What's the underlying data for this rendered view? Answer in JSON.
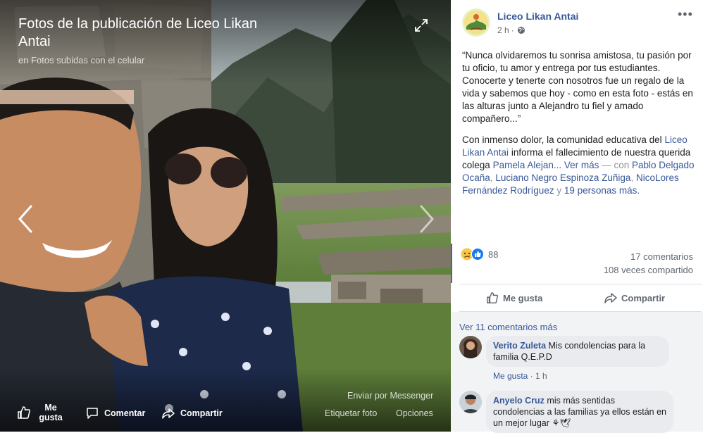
{
  "viewer": {
    "title": "Fotos de la publicación de Liceo Likan Antai",
    "subtitle": "en Fotos subidas con el celular",
    "messenger": "Enviar por Messenger",
    "like_label": "Me gusta",
    "comment_label": "Comentar",
    "share_label": "Compartir",
    "tag_label": "Etiquetar foto",
    "options_label": "Opciones"
  },
  "post": {
    "page_name": "Liceo Likan Antai",
    "time": "2 h",
    "time_sep": "·",
    "quote": "“Nunca olvidaremos tu sonrisa amistosa, tu pasión por tu oficio, tu amor y entrega por tus estudiantes. Conocerte y tenerte con nosotros fue un regalo de la vida y sabemos que hoy - como en esta foto - estás en las alturas junto a Alejandro tu fiel y amado compañero...”",
    "body_intro": "Con inmenso dolor, la comunidad educativa del",
    "body_link": "Liceo Likan Antai",
    "body_mid": "informa el fallecimiento de nuestra querida colega",
    "body_name": "Pamela Alejan...",
    "see_more": "Ver más",
    "dash": "—",
    "with": "con",
    "tag_1": "Pablo Delgado Ocaña",
    "tag_2": "Luciano Negro Espinoza Zuñiga",
    "tag_3": "NicoLores Fernández Rodríguez",
    "sep_comma": ",",
    "and": "y",
    "tag_more": "19 personas más.",
    "reaction_count": "88",
    "comments_count": "17 comentarios",
    "shares_count": "108 veces compartido",
    "like_label": "Me gusta",
    "share_label": "Compartir"
  },
  "comments": {
    "more": "Ver 11 comentarios más",
    "items": [
      {
        "name": "Verito Zuleta",
        "text": "Mis condolencias para la familia Q.E.P.D",
        "like": "Me gusta",
        "sep": "·",
        "time": "1 h"
      },
      {
        "name": "Anyelo Cruz",
        "text": "mis más sentidas condolencias a las familias ya ellos están en un mejor lugar",
        "emoji": "⚘🕊"
      }
    ]
  },
  "colors": {
    "link": "#385898",
    "accent": "#4267b2",
    "muted": "#616770"
  }
}
